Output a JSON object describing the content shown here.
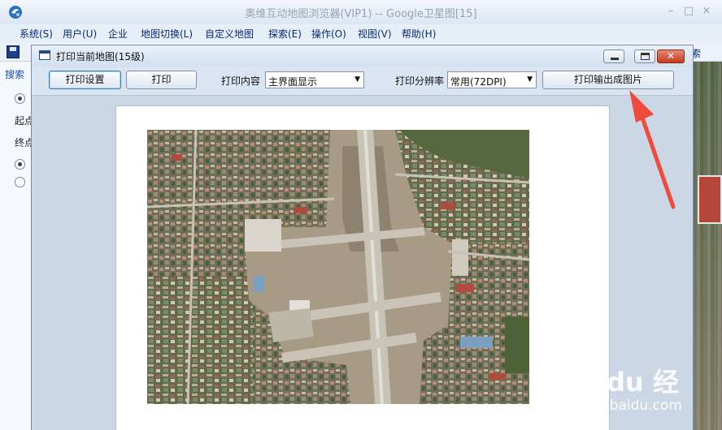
{
  "app": {
    "title": "奥维互动地图浏览器(VIP1) -- Google卫星图[15]",
    "window_controls": {
      "minimize": "–",
      "maximize": "□",
      "close": "×"
    },
    "menu": [
      "系统(S)",
      "用户(U)",
      "企业",
      "地图切换(L)",
      "自定义地图",
      "探索(E)",
      "操作(O)",
      "视图(V)",
      "帮助(H)"
    ],
    "toolbar_right_partial": "索",
    "left_panel": {
      "tab": "搜索",
      "row_start": "起点",
      "row_end": "终点"
    }
  },
  "dialog": {
    "title": "打印当前地图(15级)",
    "buttons": {
      "print_settings": "打印设置",
      "print": "打印",
      "export_image": "打印输出成图片"
    },
    "print_content": {
      "label": "打印内容",
      "value": "主界面显示"
    },
    "print_resolution": {
      "label": "打印分辨率",
      "value": "常用(72DPI)"
    }
  },
  "watermark": {
    "brand": "Bai du 经验",
    "url": "jingyan.baidu.com"
  },
  "colors": {
    "accent_arrow": "#f04a3a",
    "close_button": "#c4391f",
    "menu_text": "#0b2a78"
  }
}
